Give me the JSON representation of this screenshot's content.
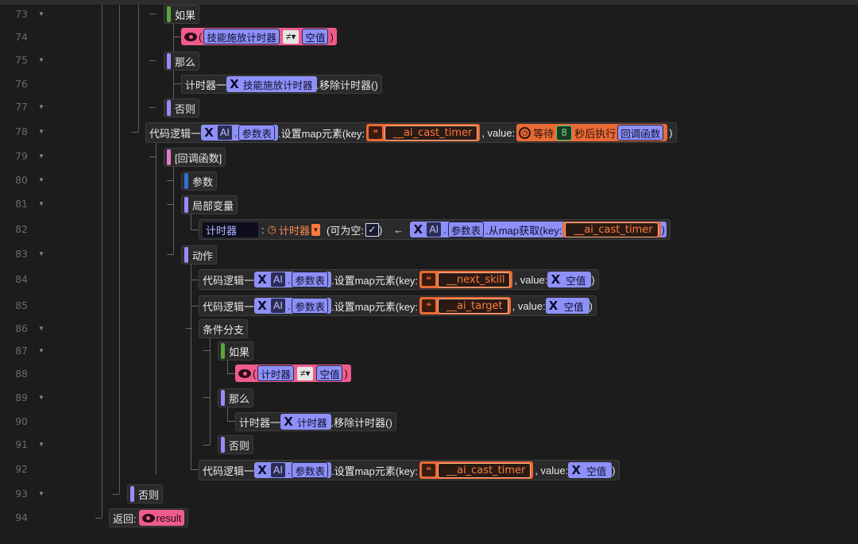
{
  "line_numbers": [
    "73",
    "74",
    "75",
    "76",
    "77",
    "78",
    "79",
    "80",
    "81",
    "82",
    "83",
    "84",
    "85",
    "86",
    "87",
    "88",
    "89",
    "90",
    "91",
    "92",
    "93",
    "94"
  ],
  "fold_icon": "chevron-down-icon",
  "keywords": {
    "if": "如果",
    "then": "那么",
    "else": "否则",
    "params": "参数",
    "locals": "局部变量",
    "actions": "动作",
    "branch": "条件分支",
    "callback": "[回调函数]",
    "return": "返回:"
  },
  "tokens": {
    "code_logic": "代码逻辑一",
    "ai": "AI",
    "param_table": "参数表",
    "dot": ".",
    "set_map": ".设置map元素(key:",
    "value_sep": ", value:",
    "close": ")",
    "open": "(",
    "neq": "≠▾",
    "null": "空值",
    "timer_prefix": "计时器一",
    "remove_timer": ".移除计时器()",
    "skill_timer": "技能施放计时器",
    "wait": "等待",
    "wait_secs": "8",
    "after_exec": "秒后执行",
    "callback_fn": "回调函数",
    "colon": ":",
    "nullable": "(可为空:",
    "arrow": "←",
    "get_from_map": ".从map获取(key:",
    "timer": "计时器",
    "timer_type": "计时器",
    "result": "result"
  },
  "strings": {
    "ai_cast_timer": "__ai_cast_timer",
    "next_skill": "__next_skill",
    "ai_target": "__ai_target"
  },
  "icons": {
    "variable": "variable-x-icon",
    "string": "quote-icon",
    "timer": "stopwatch-icon",
    "condition": "eye-icon",
    "checkbox": "check-icon"
  },
  "colors": {
    "background": "#1c1c1c",
    "if_bar": "#5aa639",
    "keyword_bar": "#9a8bff",
    "callback_bar": "#e57ac8",
    "param_bar": "#2c72d6",
    "condition_block": "#ef5c8c",
    "variable_chip": "#8d90f7",
    "string_block": "#ea6a35",
    "number_border": "#4ecb73"
  }
}
